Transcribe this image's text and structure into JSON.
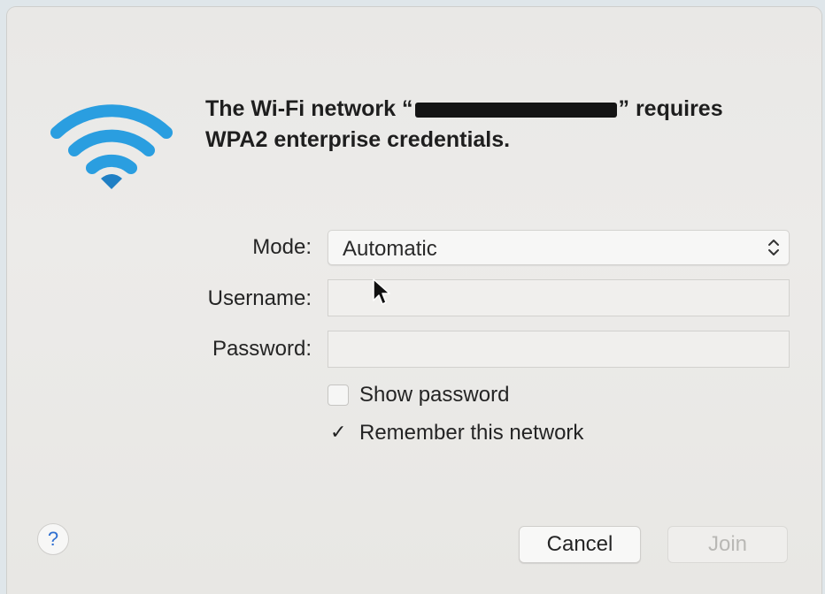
{
  "dialog": {
    "headline_before": "The Wi-Fi network “",
    "headline_after": "” requires",
    "headline_line2": "WPA2 enterprise credentials.",
    "icon": "wifi-icon",
    "accent_color": "#2a9ee0"
  },
  "form": {
    "mode_label": "Mode:",
    "mode_value": "Automatic",
    "username_label": "Username:",
    "username_value": "",
    "password_label": "Password:",
    "password_value": ""
  },
  "options": {
    "show_password_label": "Show password",
    "show_password_checked": false,
    "remember_label": "Remember this network",
    "remember_checked": true
  },
  "buttons": {
    "help": "?",
    "cancel": "Cancel",
    "join": "Join",
    "join_enabled": false
  }
}
